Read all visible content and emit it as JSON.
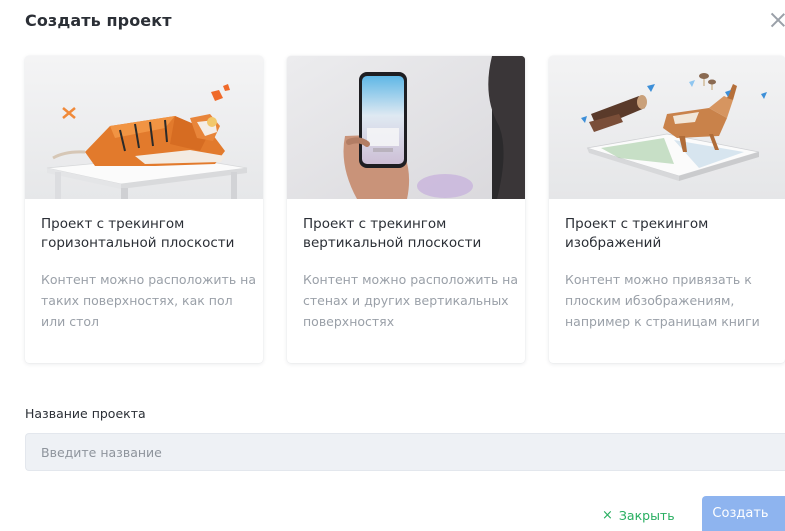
{
  "modal": {
    "title": "Создать проект"
  },
  "cards": [
    {
      "title": "Проект с трекингом горизонтальной плоскости",
      "description": "Контент можно расположить на таких поверхностях, как пол или стол",
      "image": "tiger-on-table-illustration"
    },
    {
      "title": "Проект с трекингом вертикальной плоскости",
      "description": "Контент можно расположить на стенах и других вертикальных поверхностях",
      "image": "hand-holding-phone-photo"
    },
    {
      "title": "Проект с трекингом изображений",
      "description": "Контент можно привязать к плоским ибзображениям, например к страницам книги",
      "image": "deer-on-open-book-illustration"
    }
  ],
  "form": {
    "name_label": "Название проекта",
    "name_placeholder": "Введите название",
    "name_value": ""
  },
  "footer": {
    "close_label": "Закрыть",
    "close_icon": "×",
    "create_label": "Создать"
  },
  "colors": {
    "accent_green": "#27ae60",
    "primary_button": "#8eb4ef",
    "muted_text": "#9aa0a8",
    "input_bg": "#eef1f5"
  }
}
